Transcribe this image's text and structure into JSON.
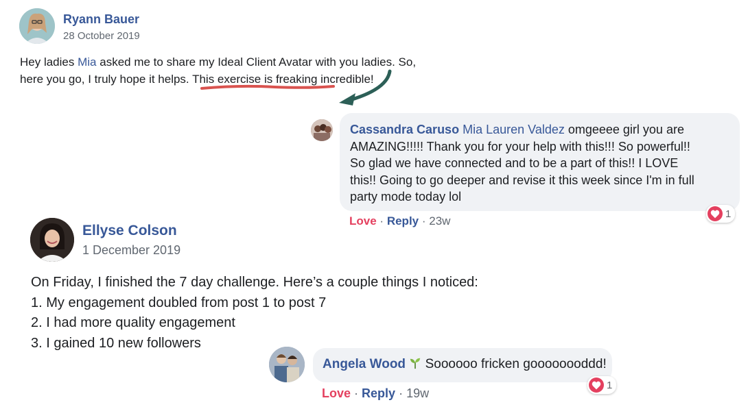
{
  "post1": {
    "author": "Ryann Bauer",
    "date": "28 October 2019",
    "text_before_mention": "Hey ladies ",
    "mention": "Mia",
    "text_line1_rest": " asked me to share my Ideal Client Avatar with you ladies. So,",
    "text_line2_plain": "here you go, I truly hope it helps. ",
    "text_line2_highlight": "This exercise is freaking incredible!"
  },
  "comment1": {
    "author": "Cassandra Caruso",
    "mention": "Mia Lauren Valdez",
    "line1_rest": " omgeeee girl you are",
    "line2": "AMAZING!!!!! Thank you for your help with this!!! So powerful!!",
    "line3": "So glad we have connected and to be a part of this!! I LOVE",
    "line4": "this!! Going to go deeper and revise it this week since I'm in full",
    "line5": "party mode today lol",
    "reaction_count": "1",
    "love_label": "Love",
    "reply_label": "Reply",
    "age": "23w"
  },
  "post2": {
    "author": "Ellyse Colson",
    "date": "1 December 2019",
    "line1": "On Friday, I finished the 7 day challenge. Here’s a couple things I noticed:",
    "line2": "1. My engagement doubled from post 1 to post 7",
    "line3": "2. I had more quality engagement",
    "line4": "3. I gained 10 new followers"
  },
  "comment2": {
    "author": "Angela Wood",
    "emoji": "🌱",
    "text": " Soooooo fricken goooooooddd!",
    "reaction_count": "1",
    "love_label": "Love",
    "reply_label": "Reply",
    "age": "19w"
  },
  "colors": {
    "name_blue": "#385898",
    "love_red": "#e4405f",
    "bubble_gray": "#f0f2f5",
    "underline_red": "#d9534f",
    "arrow_teal": "#2c5f57"
  },
  "icons": [
    "avatar-ryann",
    "avatar-cassandra",
    "avatar-ellyse",
    "avatar-angela",
    "heart-icon",
    "seedling-icon",
    "underline-annotation",
    "arrow-annotation"
  ]
}
